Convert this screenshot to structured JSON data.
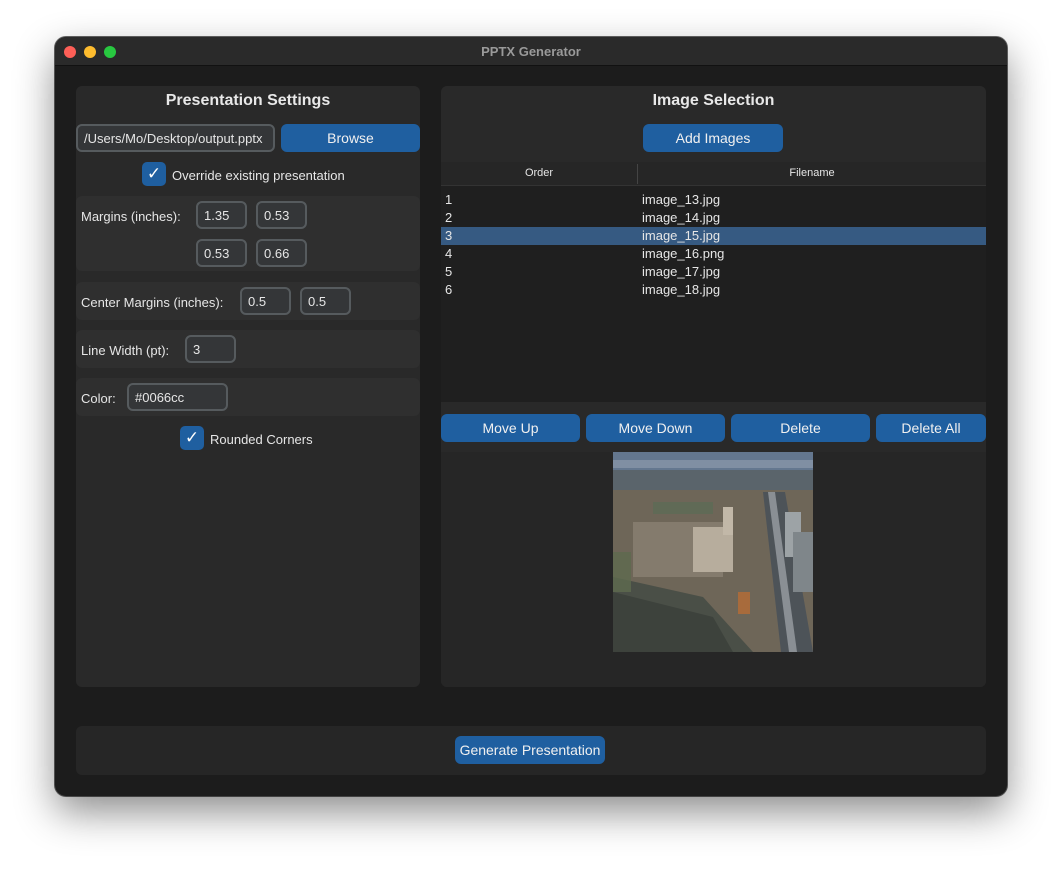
{
  "window": {
    "title": "PPTX Generator"
  },
  "settings": {
    "title": "Presentation Settings",
    "output_path": "/Users/Mo/Desktop/output.pptx",
    "browse_label": "Browse",
    "override_label": "Override existing presentation",
    "override_checked": true,
    "margins_label": "Margins (inches):",
    "margins": [
      "1.35",
      "0.53",
      "0.53",
      "0.66"
    ],
    "center_margins_label": "Center Margins (inches):",
    "center_margins": [
      "0.5",
      "0.5"
    ],
    "line_width_label": "Line Width (pt):",
    "line_width": "3",
    "color_label": "Color:",
    "color": "#0066cc",
    "rounded_label": "Rounded Corners",
    "rounded_checked": true
  },
  "images": {
    "title": "Image Selection",
    "add_label": "Add Images",
    "columns": [
      "Order",
      "Filename"
    ],
    "rows": [
      {
        "order": "1",
        "filename": "image_13.jpg"
      },
      {
        "order": "2",
        "filename": "image_14.jpg"
      },
      {
        "order": "3",
        "filename": "image_15.jpg"
      },
      {
        "order": "4",
        "filename": "image_16.png"
      },
      {
        "order": "5",
        "filename": "image_17.jpg"
      },
      {
        "order": "6",
        "filename": "image_18.jpg"
      }
    ],
    "selected_order": "3",
    "move_up_label": "Move Up",
    "move_down_label": "Move Down",
    "delete_label": "Delete",
    "delete_all_label": "Delete All"
  },
  "footer": {
    "generate_label": "Generate Presentation"
  },
  "colors": {
    "accent": "#1f5fa0",
    "selection": "#365a82",
    "window_bg": "#1c1c1c",
    "panel_bg": "#292929"
  }
}
